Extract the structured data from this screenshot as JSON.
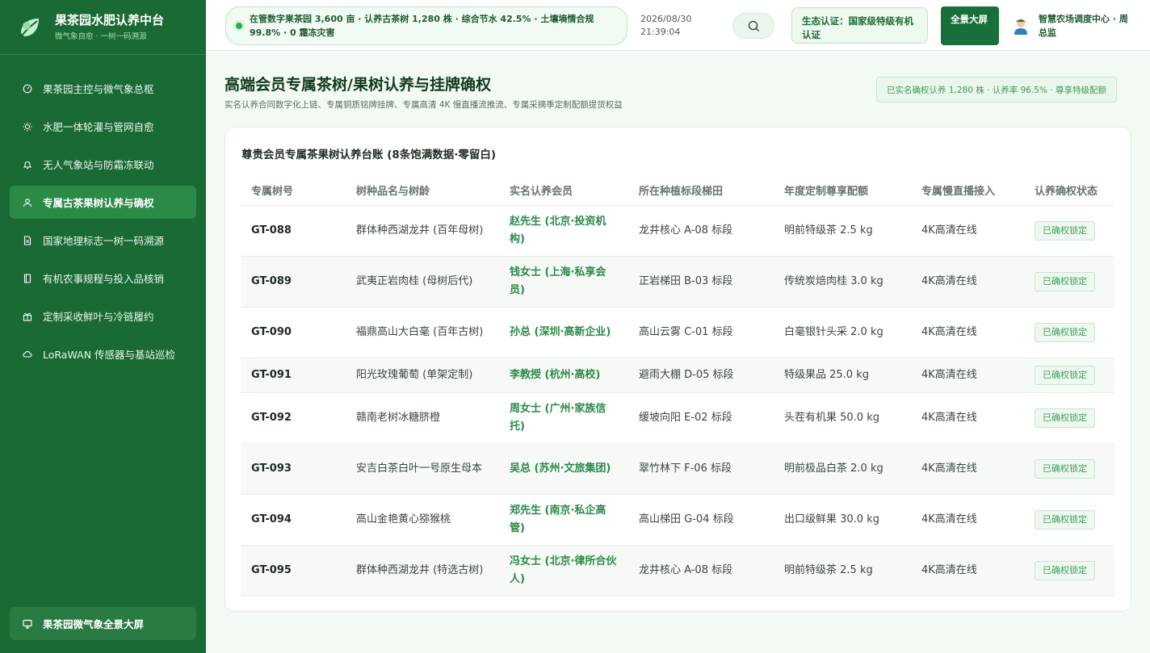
{
  "app": {
    "title": "果茶园水肥认养中台",
    "subtitle": "微气象自愈 · 一树一码溯源"
  },
  "sidebar": {
    "items": [
      {
        "label": "果茶园主控与微气象总枢",
        "icon": "gauge-icon",
        "active": false
      },
      {
        "label": "水肥一体轮灌与管网自愈",
        "icon": "sun-gear-icon",
        "active": false
      },
      {
        "label": "无人气象站与防霜冻联动",
        "icon": "bell-icon",
        "active": false
      },
      {
        "label": "专属古茶果树认养与确权",
        "icon": "user-icon",
        "active": true
      },
      {
        "label": "国家地理标志一树一码溯源",
        "icon": "document-icon",
        "active": false
      },
      {
        "label": "有机农事规程与投入品核销",
        "icon": "book-icon",
        "active": false
      },
      {
        "label": "定制采收鲜叶与冷链履约",
        "icon": "gift-icon",
        "active": false
      },
      {
        "label": "LoRaWAN 传感器与基站巡检",
        "icon": "cloud-icon",
        "active": false
      }
    ],
    "bottom": {
      "label": "果茶园微气象全景大屏",
      "icon": "monitor-icon"
    }
  },
  "header": {
    "ticker": "在管数字果茶园 3,600 亩 · 认养古茶树 1,280 株 · 综合节水 42.5% · 土壤墒情合规 99.8% · 0 霜冻灾害",
    "date": "2026/08/30",
    "time": "21:39:04",
    "search_icon": "search-icon",
    "certification": "生态认证：国家级特级有机认证",
    "fullscreen_label": "全景大屏",
    "user_name": "智慧农场调度中心 · 周总监"
  },
  "page": {
    "title": "高端会员专属茶树/果树认养与挂牌确权",
    "subtitle": "实名认养合同数字化上链、专属铜质铭牌挂牌、专属高清 4K 慢直播流推流、专属采摘季定制配额提货权益",
    "stat": "已实名确权认养 1,280 株 · 认养率 96.5% · 尊享特级配额"
  },
  "table": {
    "title": "尊贵会员专属茶果树认养台账 (8条饱满数据·零留白)",
    "columns": [
      "专属树号",
      "树种品名与树龄",
      "实名认养会员",
      "所在种植标段梯田",
      "年度定制尊享配额",
      "专属慢直播接入",
      "认养确权状态"
    ],
    "rows": [
      {
        "id": "GT-088",
        "variety": "群体种西湖龙井 (百年母树)",
        "member": "赵先生 (北京·投资机构)",
        "plot": "龙井核心 A-08 标段",
        "quota": "明前特级茶 2.5 kg",
        "live": "4K高清在线",
        "status": "已确权锁定"
      },
      {
        "id": "GT-089",
        "variety": "武夷正岩肉桂 (母树后代)",
        "member": "钱女士 (上海·私享会员)",
        "plot": "正岩梯田 B-03 标段",
        "quota": "传统炭焙肉桂 3.0 kg",
        "live": "4K高清在线",
        "status": "已确权锁定"
      },
      {
        "id": "GT-090",
        "variety": "福鼎高山大白毫 (百年古树)",
        "member": "孙总 (深圳·高新企业)",
        "plot": "高山云雾 C-01 标段",
        "quota": "白毫银针头采 2.0 kg",
        "live": "4K高清在线",
        "status": "已确权锁定"
      },
      {
        "id": "GT-091",
        "variety": "阳光玫瑰葡萄 (单架定制)",
        "member": "李教授 (杭州·高校)",
        "plot": "避雨大棚 D-05 标段",
        "quota": "特级果品 25.0 kg",
        "live": "4K高清在线",
        "status": "已确权锁定"
      },
      {
        "id": "GT-092",
        "variety": "赣南老树冰糖脐橙",
        "member": "周女士 (广州·家族信托)",
        "plot": "缓坡向阳 E-02 标段",
        "quota": "头茬有机果 50.0 kg",
        "live": "4K高清在线",
        "status": "已确权锁定"
      },
      {
        "id": "GT-093",
        "variety": "安吉白茶白叶一号原生母本",
        "member": "吴总 (苏州·文旅集团)",
        "plot": "翠竹林下 F-06 标段",
        "quota": "明前极品白茶 2.0 kg",
        "live": "4K高清在线",
        "status": "已确权锁定"
      },
      {
        "id": "GT-094",
        "variety": "高山金艳黄心猕猴桃",
        "member": "郑先生 (南京·私企高管)",
        "plot": "高山梯田 G-04 标段",
        "quota": "出口级鲜果 30.0 kg",
        "live": "4K高清在线",
        "status": "已确权锁定"
      },
      {
        "id": "GT-095",
        "variety": "群体种西湖龙井 (特选古树)",
        "member": "冯女士 (北京·律所合伙人)",
        "plot": "龙井核心 A-08 标段",
        "quota": "明前特级茶 2.5 kg",
        "live": "4K高清在线",
        "status": "已确权锁定"
      }
    ]
  },
  "colors": {
    "sidebar": "#1a6a35",
    "accent": "#2a8a48",
    "badge": "#3f9f5a"
  }
}
